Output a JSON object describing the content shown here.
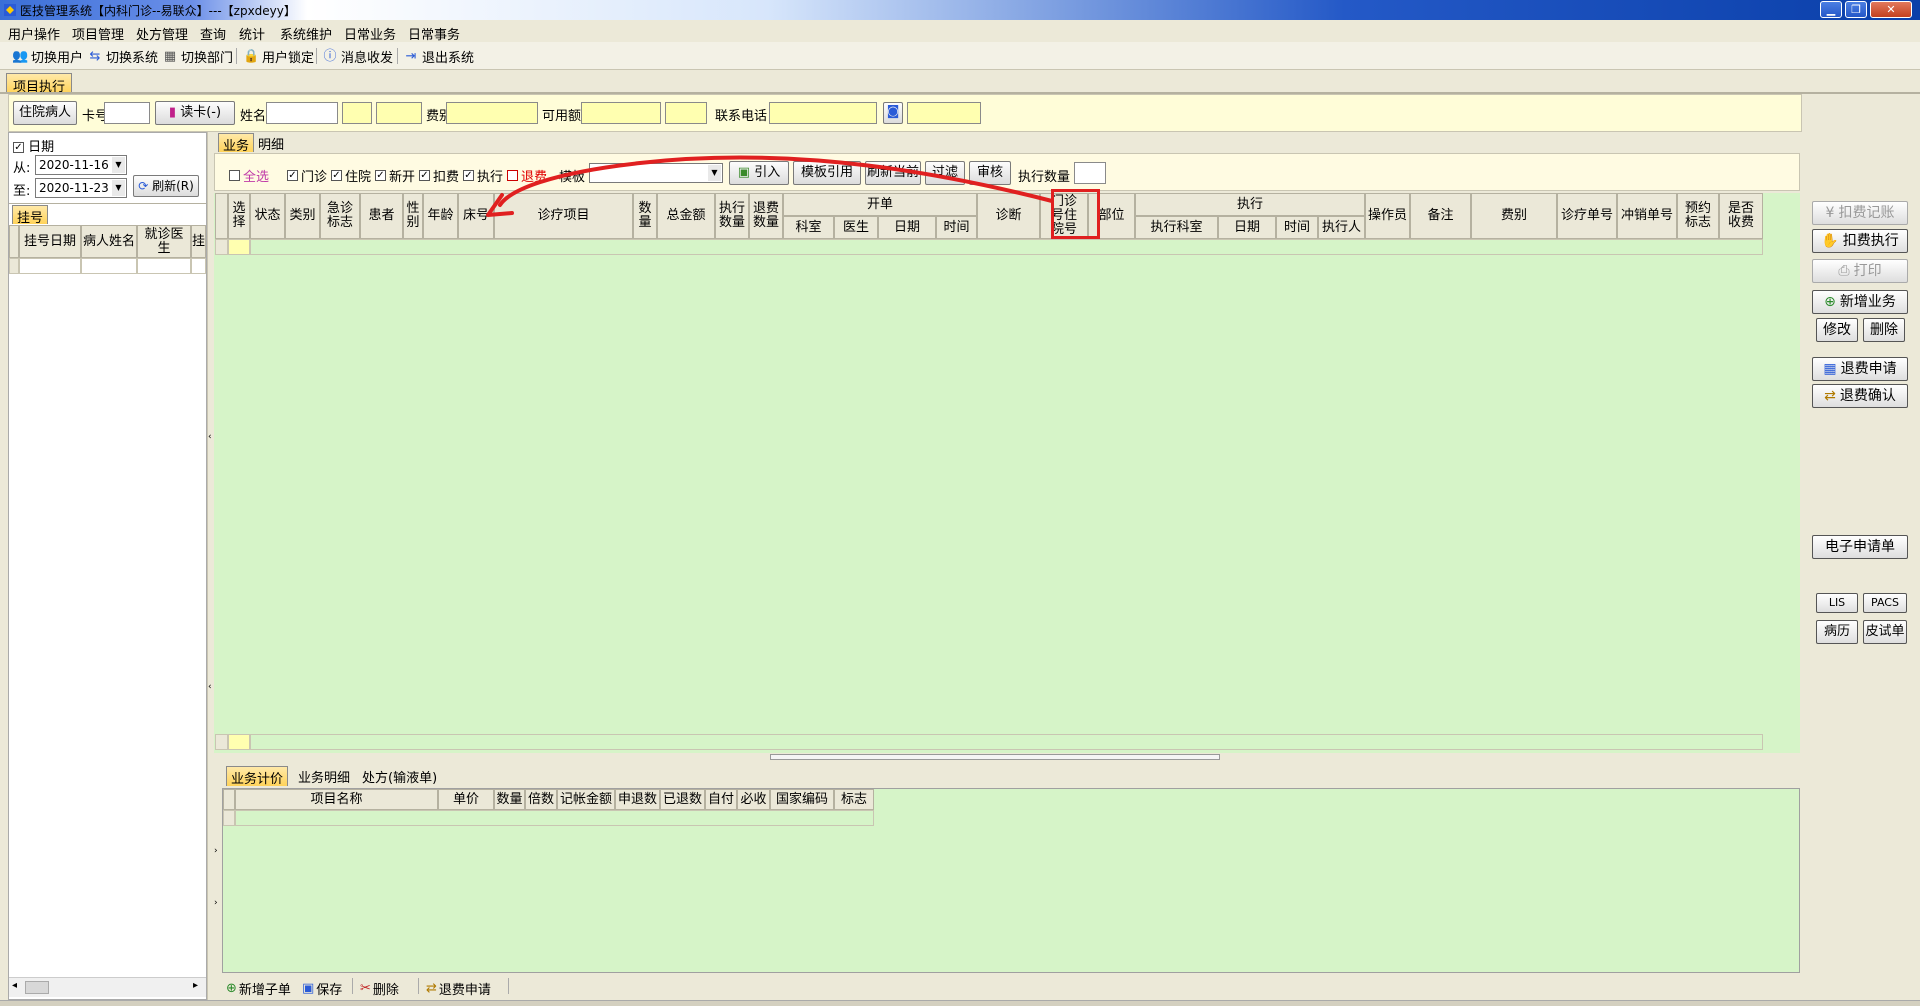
{
  "window": {
    "title": "医技管理系统【内科门诊--易联众】---【zpxdeyy】",
    "min_label": "▁",
    "restore_label": "❐",
    "close_label": "✕"
  },
  "menu": [
    "用户操作",
    "项目管理",
    "处方管理",
    "查询",
    "统计",
    "系统维护",
    "日常业务",
    "日常事务"
  ],
  "toolbar": {
    "switch_user": "切换用户",
    "switch_system": "切换系统",
    "switch_dept": "切换部门",
    "user_lock": "用户锁定",
    "message": "消息收发",
    "exit": "退出系统"
  },
  "main_tab": "项目执行",
  "search": {
    "inpatient_btn": "住院病人",
    "card_label": "卡号",
    "card_value": "",
    "read_card_btn": "读卡(-)",
    "name_label": "姓名",
    "name_value": "",
    "fee_type_label": "费别",
    "available_label": "可用额",
    "phone_label": "联系电话"
  },
  "left": {
    "date_label": "日期",
    "from_label": "从:",
    "from_value": "2020-11-16",
    "to_label": "至:",
    "to_value": "2020-11-23",
    "refresh_btn": "刷新(R)",
    "tab_label": "挂号",
    "columns": [
      "挂号日期",
      "病人姓名",
      "就诊医生",
      "挂"
    ]
  },
  "business_tabs": [
    "业务",
    "明细"
  ],
  "filter": {
    "select_all": "全选",
    "outpatient": "门诊",
    "inpatient": "住院",
    "new": "新开",
    "charge": "扣费",
    "execute": "执行",
    "refund": "退费",
    "template_label": "模板",
    "import_btn": "引入",
    "template_ref_btn": "模板引用",
    "refresh_prev_btn": "刷新当前",
    "filter_btn": "过滤",
    "audit_btn": "审核",
    "exec_count_label": "执行数量"
  },
  "main_grid": {
    "columns": [
      "选择",
      "状态",
      "类别",
      "急诊标志",
      "患者",
      "性别",
      "年龄",
      "床号",
      "诊疗项目",
      "数量",
      "总金额",
      "执行数量",
      "退费数量",
      "开单",
      "诊断",
      "门诊号住院号",
      "部位",
      "执行",
      "操作员",
      "备注",
      "费别",
      "诊疗单号",
      "冲销单号",
      "预约标志",
      "是否收费"
    ],
    "kaidan_sub": [
      "科室",
      "医生",
      "日期",
      "时间"
    ],
    "zhixing_sub": [
      "执行科室",
      "日期",
      "时间",
      "执行人"
    ],
    "highlight_color": "#e02020"
  },
  "right_buttons": {
    "charge_record": "扣费记账",
    "charge_execute": "扣费执行",
    "print": "打印",
    "add_business": "新增业务",
    "modify": "修改",
    "delete": "删除",
    "refund_request": "退费申请",
    "refund_confirm": "退费确认",
    "e_request": "电子申请单",
    "lis": "LIS",
    "pacs": "PACS",
    "medical_record": "病历",
    "skin_test": "皮试单"
  },
  "bottom_tabs": [
    "业务计价",
    "业务明细",
    "处方(输液单)"
  ],
  "bottom_grid": {
    "columns": [
      "项目名称",
      "单价",
      "数量",
      "倍数",
      "记帐金额",
      "申退数",
      "已退数",
      "自付",
      "必收",
      "国家编码",
      "标志"
    ]
  },
  "bottom_bar": {
    "add_sub": "新增子单",
    "save": "保存",
    "delete": "删除",
    "refund_request": "退费申请"
  }
}
